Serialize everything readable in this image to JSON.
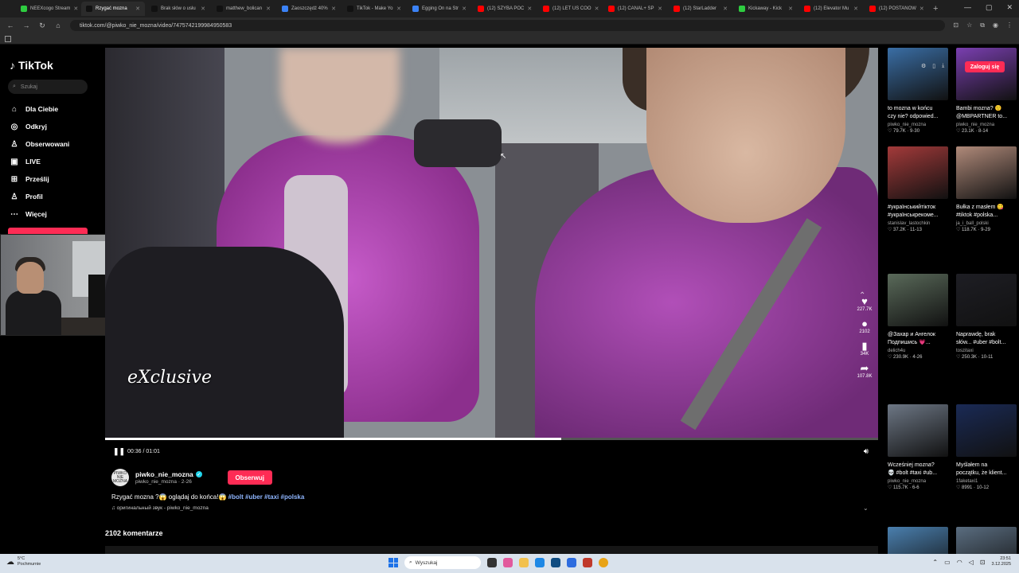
{
  "browser": {
    "tabs": [
      {
        "title": "NEEXcogo Stream",
        "color": "#2ecc40"
      },
      {
        "title": "Rzygać mozna",
        "color": "#111111",
        "active": true
      },
      {
        "title": "Brak słów o usłu",
        "color": "#111111"
      },
      {
        "title": "matthew_bolican",
        "color": "#111111"
      },
      {
        "title": "Zaoszczędź 40%",
        "color": "#3b82f6"
      },
      {
        "title": "TikTok - Make Yo",
        "color": "#111111"
      },
      {
        "title": "Egging On na Str",
        "color": "#3b82f6"
      },
      {
        "title": "(12) SZYBA POC",
        "color": "#ff0000"
      },
      {
        "title": "(12) LET US COO",
        "color": "#ff0000"
      },
      {
        "title": "(12) CANAL+ SP",
        "color": "#ff0000"
      },
      {
        "title": "(12) StarLadder",
        "color": "#ff0000"
      },
      {
        "title": "Kickaway - Kick",
        "color": "#2ecc40"
      },
      {
        "title": "(12) Elevator Mu",
        "color": "#ff0000"
      },
      {
        "title": "(12) POSTANOW",
        "color": "#ff0000"
      }
    ],
    "new_tab": "+",
    "url": "tiktok.com/@piwko_nie_mozna/video/7475742199984950583"
  },
  "sidebar": {
    "logo": "TikTok",
    "search_placeholder": "Szukaj",
    "items": [
      {
        "label": "Dla Ciebie",
        "icon": "home-icon",
        "glyph": "⌂"
      },
      {
        "label": "Odkryj",
        "icon": "compass-icon",
        "glyph": "◎"
      },
      {
        "label": "Obserwowani",
        "icon": "user-follow-icon",
        "glyph": "♙"
      },
      {
        "label": "LIVE",
        "icon": "live-icon",
        "glyph": "▣"
      },
      {
        "label": "Prześlij",
        "icon": "upload-icon",
        "glyph": "⊞"
      },
      {
        "label": "Profil",
        "icon": "profile-icon",
        "glyph": "♙"
      },
      {
        "label": "Więcej",
        "icon": "more-icon",
        "glyph": "⋯"
      }
    ]
  },
  "video": {
    "overlay_text": "eXclusive",
    "actions": [
      {
        "icon": "heart-icon",
        "glyph": "♥",
        "count": "227.7K"
      },
      {
        "icon": "comment-icon",
        "glyph": "●",
        "count": "2102"
      },
      {
        "icon": "bookmark-icon",
        "glyph": "▮",
        "count": "34K"
      },
      {
        "icon": "share-icon",
        "glyph": "➦",
        "count": "107.8K"
      }
    ],
    "time": "00:36 / 01:01",
    "progress": 0.59
  },
  "author": {
    "name": "piwko_nie_mozna",
    "sub": "piwko_nie_mozna · 2-26",
    "avatar_text": "PIWKO NIE MOŻNA",
    "follow_label": "Obserwuj"
  },
  "caption": {
    "text": "Rzygać mozna ?😱 oglądaj do końca!😱 ",
    "tags": [
      "#bolt",
      "#uber",
      "#taxi",
      "#polska"
    ],
    "sound": "♫ оригинальный звук - piwko_nie_mozna"
  },
  "comments_label": "2102 komentarze",
  "top_right": {
    "login_label": "Zaloguj się"
  },
  "grid": [
    {
      "title": "to mozna w końcu czy nie? odpowied...",
      "author": "piwko_nie_mozna",
      "meta": "♡ 79.7K · 9-30",
      "color": "#3a6ea5"
    },
    {
      "title": "Bambi mozna? 🙂 @MBPARTNER to...",
      "author": "piwko_nie_mozna",
      "meta": "♡ 23.1K · 8-14",
      "color": "#7a3fb0"
    },
    {
      "title": "#українськийтікток #українськрекоме...",
      "author": "stanislav_lastochkin",
      "meta": "♡ 37.2K · 11-13",
      "color": "#a33a3a"
    },
    {
      "title": "Bułka z masłem 😋 #tiktok #polska...",
      "author": "ja_i_ball_polski",
      "meta": "♡ 118.7K · 9-29",
      "color": "#b08a7a"
    },
    {
      "title": "@Захар и Ангелок Подпишись 💗...",
      "author": "delich4u",
      "meta": "♡ 230.9K · 4-26",
      "color": "#5a6a5a"
    },
    {
      "title": "Naprawdę, brak słów... #uber #bolt...",
      "author": "toszitaxi",
      "meta": "♡ 250.3K · 10-11",
      "color": "#1e1e24"
    },
    {
      "title": "Wcześniej mozna? 💀 #bolt #taxi #ub...",
      "author": "piwko_nie_mozna",
      "meta": "♡ 115.7K · 6-6",
      "color": "#6d7785"
    },
    {
      "title": "Myślałem na początku, że klient...",
      "author": "1faketaxi1",
      "meta": "♡ 8991 · 10-12",
      "color": "#1a2a55"
    },
    {
      "title": "",
      "author": "",
      "meta": "",
      "color": "#4a7fae"
    },
    {
      "title": "",
      "author": "",
      "meta": "",
      "color": "#5a6d80"
    }
  ],
  "taskbar": {
    "weather_temp": "5°C",
    "weather_desc": "Pochmurnie",
    "search_placeholder": "Wyszukaj",
    "time": "23:51",
    "date": "3.12.2025"
  }
}
